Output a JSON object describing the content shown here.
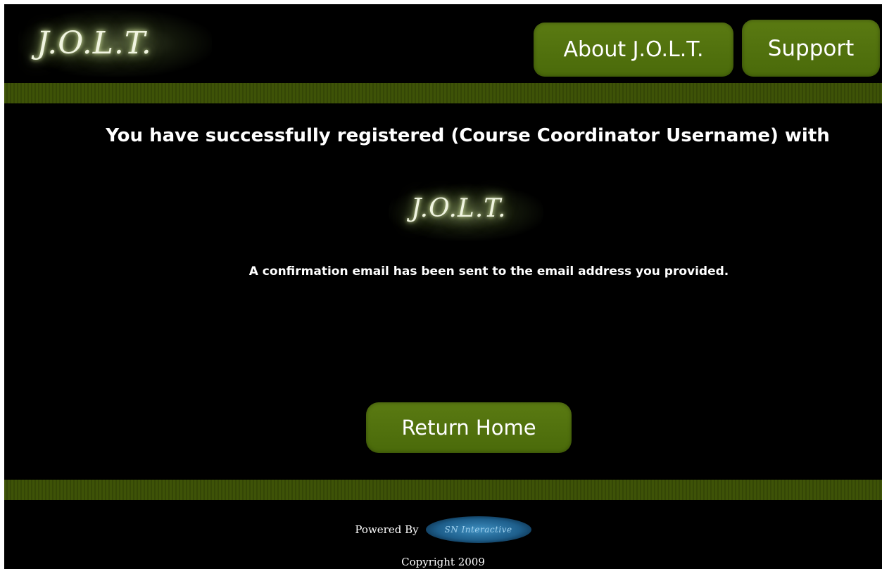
{
  "header": {
    "logo_text": "J.O.L.T.",
    "nav": {
      "about_label": "About J.O.L.T.",
      "support_label": "Support"
    }
  },
  "main": {
    "success_message": "You have successfully registered (Course Coordinator Username) with",
    "logo_text": "J.O.L.T.",
    "confirmation_message": "A confirmation email has been sent to the email address you provided.",
    "return_home_label": "Return Home"
  },
  "footer": {
    "powered_by_label": "Powered By",
    "sponsor_logo_text": "SN Interactive",
    "copyright": "Copyright 2009"
  },
  "colors": {
    "background": "#000000",
    "accent_green": "#4a6a0a",
    "stripe_green": "#3e5307",
    "text": "#ffffff"
  }
}
